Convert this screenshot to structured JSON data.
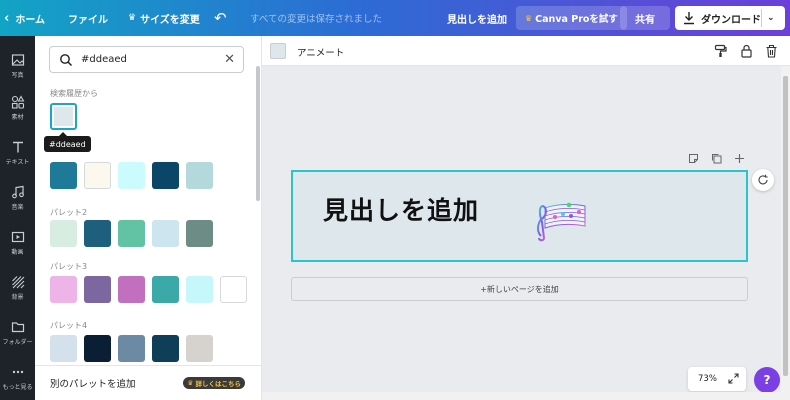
{
  "topbar": {
    "home": "ホーム",
    "file": "ファイル",
    "resize": "サイズを変更",
    "saved_status": "すべての変更は保存されました",
    "add_heading": "見出しを追加",
    "pro": "Canva Proを試す",
    "share": "共有",
    "download": "ダウンロード"
  },
  "rail": {
    "items": [
      {
        "label": "写真",
        "icon": "photo-icon"
      },
      {
        "label": "素材",
        "icon": "elements-icon"
      },
      {
        "label": "テキスト",
        "icon": "text-icon"
      },
      {
        "label": "音楽",
        "icon": "music-icon"
      },
      {
        "label": "動画",
        "icon": "video-icon"
      },
      {
        "label": "背景",
        "icon": "background-icon"
      },
      {
        "label": "フォルダー",
        "icon": "folder-icon"
      },
      {
        "label": "もっと見る",
        "icon": "more-icon"
      }
    ]
  },
  "panel": {
    "search_value": "#ddeaed",
    "history_label": "検索履歴から",
    "tooltip": "#ddeaed",
    "history_colors": [
      "#dde7ec"
    ],
    "palettes": [
      {
        "label": "",
        "colors": [
          "#1f7a99",
          "#fdf8ee",
          "#ccfbfe",
          "#0b4668",
          "#b3d9dc"
        ]
      },
      {
        "label": "パレット2",
        "colors": [
          "#d8ede2",
          "#1d5f7c",
          "#62c2a4",
          "#cce5ef",
          "#6e8c86"
        ]
      },
      {
        "label": "パレット3",
        "colors": [
          "#eeb4e7",
          "#7c67a0",
          "#c26fbf",
          "#3aa9a8",
          "#c6f8fb",
          "#ffffff"
        ]
      },
      {
        "label": "パレット4",
        "colors": [
          "#d4e1ec",
          "#0a1f33",
          "#6c8aa3",
          "#0f3e58",
          "#d6d2cd"
        ]
      }
    ],
    "add_palette": "別のパレットを追加",
    "learn_more": "詳しくはこちら"
  },
  "canvas": {
    "animate": "アニメート",
    "heading_text": "見出しを追加",
    "add_page": "+新しいページを追加",
    "zoom": "73%",
    "help": "?"
  },
  "colors": {
    "accent": "#28c6cc",
    "rail_bg": "#1e2329",
    "page_bg": "#dde7ec",
    "help_bg": "#7b3fe4"
  }
}
